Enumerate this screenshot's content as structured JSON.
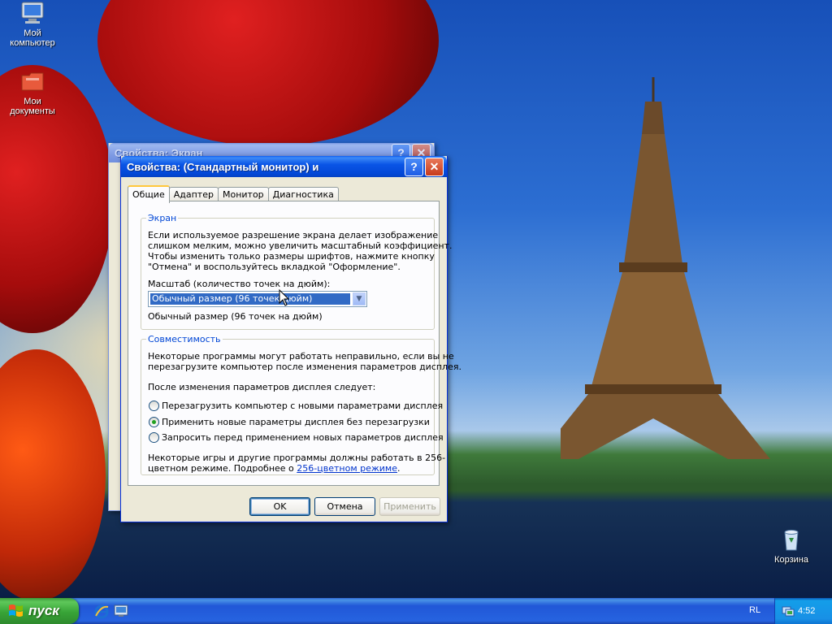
{
  "desktop": {
    "icons": [
      {
        "label_line1": "Мой",
        "label_line2": "компьютер",
        "icon": "my-computer-icon"
      },
      {
        "label_line1": "Мои",
        "label_line2": "документы",
        "icon": "my-documents-icon"
      },
      {
        "label_line1": "Корзина",
        "label_line2": "",
        "icon": "recycle-bin-icon"
      }
    ]
  },
  "bg_window": {
    "title": "Свойства: Экран"
  },
  "dialog": {
    "title": "Свойства: (Стандартный монитор) и",
    "help_glyph": "?",
    "close_glyph": "✕",
    "tabs": [
      "Общие",
      "Адаптер",
      "Монитор",
      "Диагностика"
    ],
    "active_tab": "Общие",
    "screen_group": {
      "legend": "Экран",
      "description": [
        "Если используемое разрешение экрана делает изображение",
        "слишком мелким, можно увеличить масштабный коэффициент.",
        "Чтобы изменить только размеры шрифтов, нажмите кнопку",
        "\"Отмена\" и воспользуйтесь вкладкой \"Оформление\"."
      ],
      "dpi_label": "Масштаб (количество точек на дюйм):",
      "dpi_selected": "Обычный размер (96 точек/дюйм)",
      "dpi_note": "Обычный размер (96 точек на дюйм)"
    },
    "compat_group": {
      "legend": "Совместимость",
      "description": [
        "Некоторые программы могут работать неправильно, если вы не",
        "перезагрузите компьютер после изменения параметров дисплея."
      ],
      "after_change_label": "После изменения параметров дисплея следует:",
      "options": [
        "Перезагрузить компьютер с новыми параметрами дисплея",
        "Применить новые параметры дисплея без перезагрузки",
        "Запросить перед применением новых параметров дисплея"
      ],
      "selected_option": 1,
      "games_note_line1": "Некоторые игры и другие программы должны работать в 256-",
      "games_note_prefix": "цветном режиме. Подробнее о ",
      "games_note_link": "256-цветном режиме",
      "games_note_suffix": "."
    },
    "buttons": {
      "ok": "OK",
      "cancel": "Отмена",
      "apply": "Применить"
    }
  },
  "taskbar": {
    "start_label": "пуск",
    "quick_launch": [
      "internet-explorer-icon",
      "show-desktop-icon"
    ],
    "language": "RL",
    "clock": "4:52"
  }
}
